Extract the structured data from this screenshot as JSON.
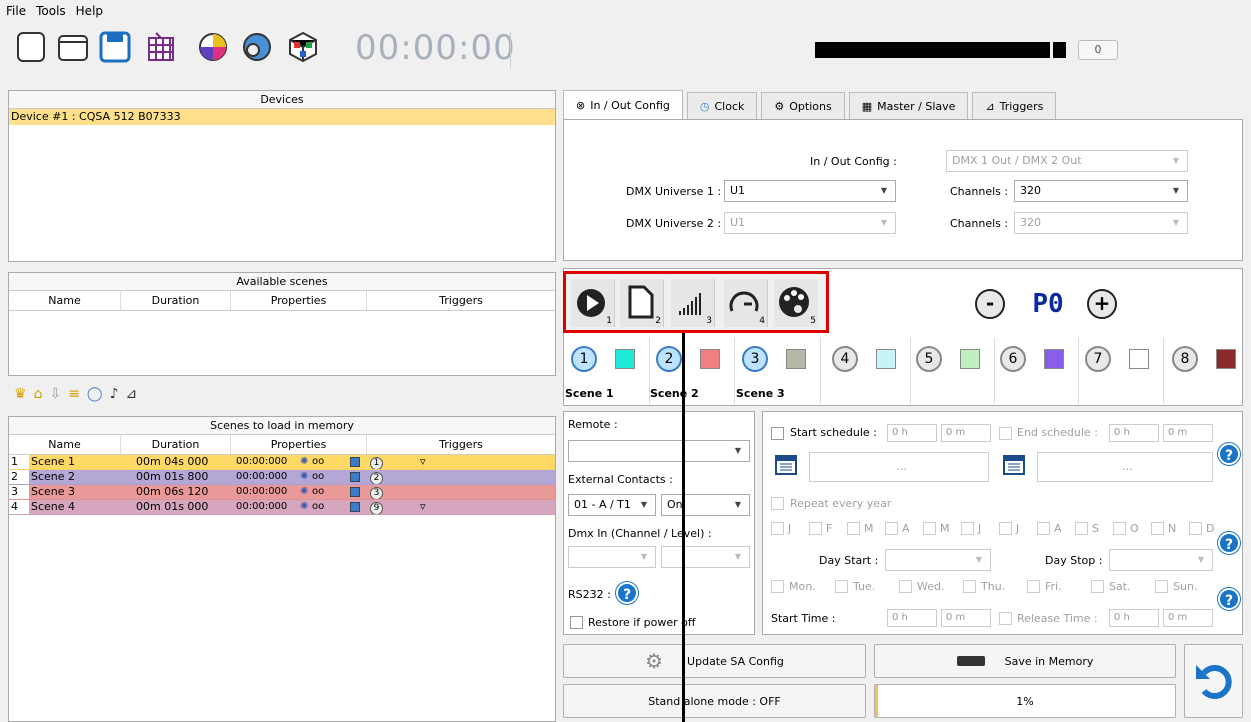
{
  "menu": [
    "File",
    "Tools",
    "Help"
  ],
  "toolbar": {
    "time": "00:00:00",
    "level_value": "0"
  },
  "devices": {
    "title": "Devices",
    "items": [
      "Device #1 : CQSA 512 B07333"
    ]
  },
  "available_scenes": {
    "title": "Available scenes",
    "columns": [
      "Name",
      "Duration",
      "Properties",
      "Triggers"
    ]
  },
  "memory_scenes": {
    "title": "Scenes to load in memory",
    "columns": [
      "Name",
      "Duration",
      "Properties",
      "Triggers"
    ],
    "rows": [
      {
        "num": "1",
        "name": "Scene 1",
        "duration": "00m 04s 000",
        "time": "00:00:000",
        "loop": "oo",
        "trigger_num": "1",
        "color": "#ffd966",
        "has_trigger": true
      },
      {
        "num": "2",
        "name": "Scene 2",
        "duration": "00m 01s 800",
        "time": "00:00:000",
        "loop": "oo",
        "trigger_num": "2",
        "color": "#b4a7d6",
        "has_trigger": false
      },
      {
        "num": "3",
        "name": "Scene 3",
        "duration": "00m 06s 120",
        "time": "00:00:000",
        "loop": "oo",
        "trigger_num": "3",
        "color": "#ea9999",
        "has_trigger": false
      },
      {
        "num": "4",
        "name": "Scene 4",
        "duration": "00m 01s 000",
        "time": "00:00:000",
        "loop": "oo",
        "trigger_num": "9",
        "color": "#d5a6bd",
        "has_trigger": true
      }
    ]
  },
  "tabs": [
    "In / Out Config",
    "Clock",
    "Options",
    "Master / Slave",
    "Triggers"
  ],
  "config": {
    "io_label": "In / Out Config :",
    "io_value": "DMX 1 Out / DMX 2 Out",
    "u1_label": "DMX Universe 1 :",
    "u1_value": "U1",
    "u2_label": "DMX Universe 2 :",
    "u2_value": "U1",
    "ch1_label": "Channels :",
    "ch1_value": "320",
    "ch2_label": "Channels :",
    "ch2_value": "320"
  },
  "mode_buttons": [
    {
      "sub": "1",
      "icon": "play-icon"
    },
    {
      "sub": "2",
      "icon": "page-icon"
    },
    {
      "sub": "3",
      "icon": "signal-bars-icon"
    },
    {
      "sub": "4",
      "icon": "speedometer-icon"
    },
    {
      "sub": "5",
      "icon": "palette-icon"
    }
  ],
  "program": {
    "minus": "-",
    "value": "P0",
    "plus": "+"
  },
  "scene_slots": [
    {
      "num": "1",
      "color": "#1de9d6",
      "label": "Scene 1",
      "selected": true
    },
    {
      "num": "2",
      "color": "#f08080",
      "label": "Scene 2",
      "selected": true
    },
    {
      "num": "3",
      "color": "#b8b8a8",
      "label": "Scene 3",
      "selected": true
    },
    {
      "num": "4",
      "color": "#c8f4f8",
      "label": "",
      "selected": false
    },
    {
      "num": "5",
      "color": "#c0f0c0",
      "label": "",
      "selected": false
    },
    {
      "num": "6",
      "color": "#8860e8",
      "label": "",
      "selected": false
    },
    {
      "num": "7",
      "color": "#ffffff",
      "label": "",
      "selected": false
    },
    {
      "num": "8",
      "color": "#8b2a2a",
      "label": "",
      "selected": false
    }
  ],
  "remote": {
    "remote_label": "Remote :",
    "ext_label": "External Contacts :",
    "ext_value1": "01 - A / T1",
    "ext_value2": "On",
    "dmxin_label": "Dmx In (Channel / Level) :",
    "rs232_label": "RS232 :",
    "restore_label": "Restore if power off"
  },
  "schedule": {
    "start_label": "Start schedule :",
    "start_h": "0 h",
    "start_m": "0 m",
    "end_label": "End schedule :",
    "end_h": "0 h",
    "end_m": "0 m",
    "date_placeholder": "...",
    "repeat_label": "Repeat every year",
    "months": [
      "J",
      "F",
      "M",
      "A",
      "M",
      "J",
      "J",
      "A",
      "S",
      "O",
      "N",
      "D"
    ],
    "day_start_label": "Day Start :",
    "day_stop_label": "Day Stop :",
    "days": [
      "Mon.",
      "Tue.",
      "Wed.",
      "Thu.",
      "Fri.",
      "Sat.",
      "Sun."
    ],
    "start_time_label": "Start Time :",
    "st_h": "0 h",
    "st_m": "0 m",
    "release_label": "Release Time :",
    "rt_h": "0 h",
    "rt_m": "0 m"
  },
  "actions": {
    "update": "Update SA Config",
    "save": "Save in Memory",
    "standalone": "Stand alone mode : OFF",
    "progress": "1%"
  },
  "colors": {
    "highlight_red": "#e00000",
    "selected_device": "#ffe08a"
  }
}
